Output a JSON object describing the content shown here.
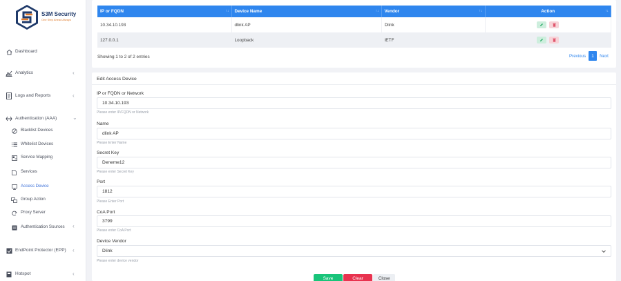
{
  "brand": {
    "name": "S3M Security",
    "tagline": "One Step Ahead Always"
  },
  "sidebar": {
    "items": [
      {
        "label": "Dashboard",
        "icon": "home-icon"
      },
      {
        "label": "Analytics",
        "icon": "chart-icon"
      },
      {
        "label": "Logs and Reports",
        "icon": "document-icon"
      },
      {
        "label": "Authentication (AAA)",
        "icon": "arrows-icon"
      },
      {
        "label": "EndPoint Protector (EPP)",
        "icon": "shield-icon"
      },
      {
        "label": "Hotspot",
        "icon": "hotspot-icon"
      }
    ],
    "auth_sub": [
      {
        "label": "Blacklist Devices"
      },
      {
        "label": "Whitelist Devices"
      },
      {
        "label": "Service Mapping"
      },
      {
        "label": "Services"
      },
      {
        "label": "Access Device"
      },
      {
        "label": "Group Action"
      },
      {
        "label": "Proxy Server"
      },
      {
        "label": "Authentication Sources"
      }
    ]
  },
  "table": {
    "headers": [
      "IP or FQDN",
      "Device Name",
      "Vendor",
      "Action"
    ],
    "rows": [
      {
        "ip": "10.34.10.193",
        "name": "dlink AP",
        "vendor": "Dlink"
      },
      {
        "ip": "127.0.0.1",
        "name": "Loopback",
        "vendor": "IETF"
      }
    ],
    "info": "Showing 1 to 2 of 2 entries",
    "pagination": {
      "previous": "Previous",
      "page": "1",
      "next": "Next"
    }
  },
  "form": {
    "title": "Edit Access Device",
    "fields": {
      "ip": {
        "label": "IP or FQDN or Network",
        "value": "10.34.10.193",
        "help": "Please enter IP/FQDN or Network"
      },
      "name": {
        "label": "Name",
        "value": "dlink AP",
        "help": "Please Enter Name"
      },
      "secret": {
        "label": "Secret Key",
        "value": "Deneme12",
        "help": "Please enter Secret Key"
      },
      "port": {
        "label": "Port",
        "value": "1812",
        "help": "Please Enter Port"
      },
      "coa": {
        "label": "CoA Port",
        "value": "3799",
        "help": "Please enter CoA Port"
      },
      "vendor": {
        "label": "Device Vendor",
        "value": "Dlink",
        "help": "Please enter device vendor"
      }
    },
    "buttons": {
      "save": "Save",
      "clear": "Clear",
      "close": "Close"
    }
  },
  "colors": {
    "primary": "#2f86ee",
    "save": "#19c47a",
    "clear": "#e8334f",
    "brand_orange": "#e07a2b",
    "brand_navy": "#1f3a6a"
  }
}
